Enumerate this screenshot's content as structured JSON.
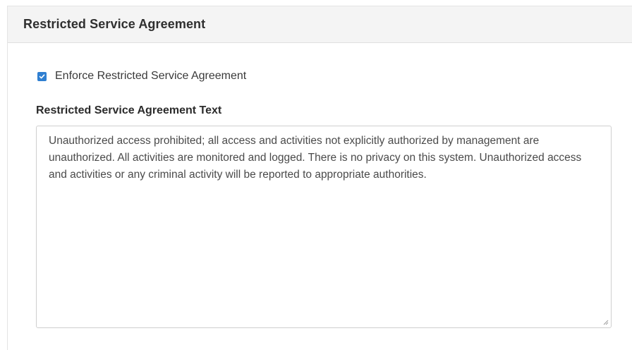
{
  "panel": {
    "title": "Restricted Service Agreement"
  },
  "enforce": {
    "checked": true,
    "label": "Enforce Restricted Service Agreement"
  },
  "agreement_text": {
    "label": "Restricted Service Agreement Text",
    "value": "Unauthorized access prohibited; all access and activities not explicitly authorized by management are unauthorized. All activities are monitored and logged. There is no privacy on this system. Unauthorized access and activities or any criminal activity will be reported to appropriate authorities."
  },
  "colors": {
    "checkbox_accent": "#2f7fd1",
    "header_background": "#f4f4f4"
  }
}
